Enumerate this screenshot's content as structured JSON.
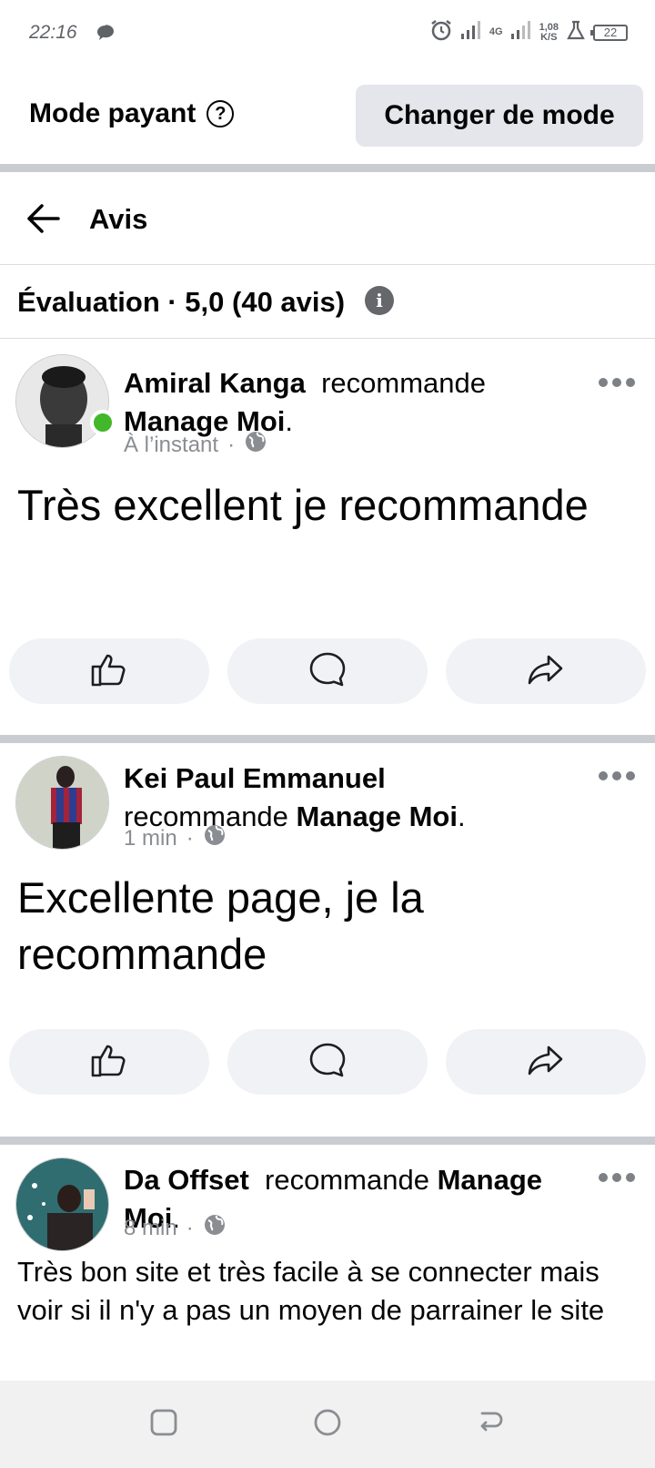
{
  "status_bar": {
    "time": "22:16",
    "network": "4G",
    "speed_value": "1,08",
    "speed_unit": "K/S",
    "battery": "22"
  },
  "mode_bar": {
    "label": "Mode payant",
    "help_glyph": "?",
    "switch_button": "Changer de mode"
  },
  "nav": {
    "title": "Avis"
  },
  "rating": {
    "text": "Évaluation · 5,0 (40 avis)",
    "info_glyph": "i"
  },
  "posts": [
    {
      "author": "Amiral Kanga",
      "action": "recommande",
      "page": "Manage Moi",
      "period": ".",
      "time": "À l’instant",
      "separator": "·",
      "online": true,
      "text": "Très excellent je recommande"
    },
    {
      "author": "Kei Paul Emmanuel",
      "action": "recommande",
      "page": "Manage Moi",
      "period": ".",
      "time": "1 min",
      "separator": "·",
      "online": false,
      "text": "Excellente page, je la recommande"
    },
    {
      "author": "Da Offset",
      "action": "recommande",
      "page": "Manage Moi",
      "period": ".",
      "time": "8 min",
      "separator": "·",
      "online": false,
      "text": "Très bon site et très facile à se connecter mais voir si il n'y a pas un moyen de parrainer le site"
    }
  ],
  "icons": {
    "like": "thumbs-up-icon",
    "comment": "comment-icon",
    "share": "share-icon",
    "more": "more-dots-icon",
    "privacy": "globe-icon"
  },
  "colors": {
    "online": "#42b72a",
    "button_bg": "#e4e6eb",
    "action_bg": "#f0f2f5",
    "meta": "#8a8d91"
  }
}
